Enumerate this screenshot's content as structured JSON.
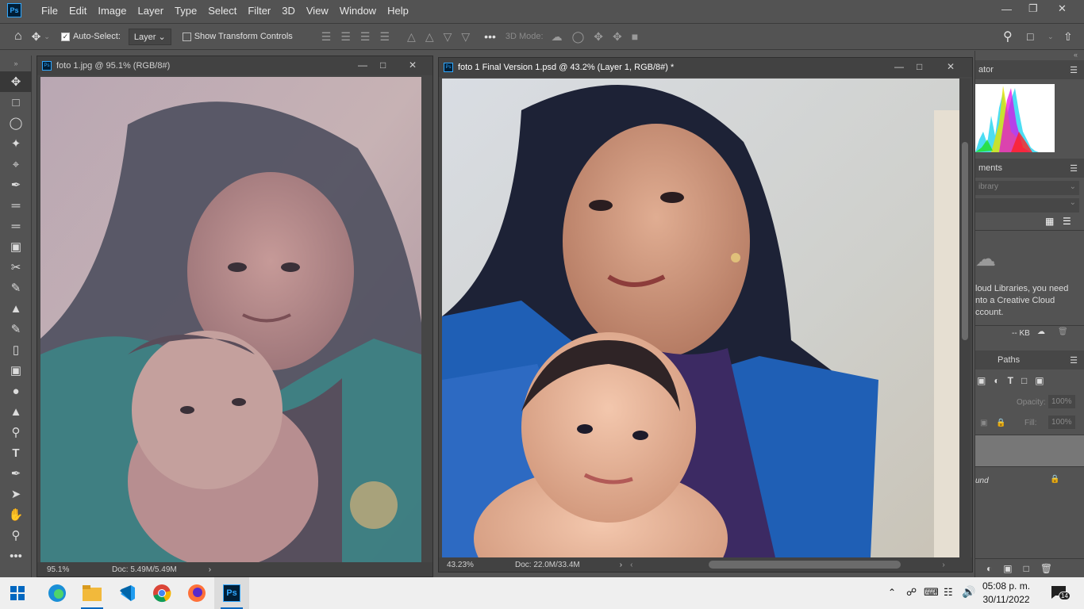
{
  "menubar": {
    "logo": "Ps",
    "items": [
      "File",
      "Edit",
      "Image",
      "Layer",
      "Type",
      "Select",
      "Filter",
      "3D",
      "View",
      "Window",
      "Help"
    ]
  },
  "optbar": {
    "auto_select_label": "Auto-Select:",
    "auto_select_target": "Layer",
    "show_transform_label": "Show Transform Controls",
    "mode_label": "3D Mode:"
  },
  "doc1": {
    "title": "foto 1.jpg @ 95.1% (RGB/8#)",
    "zoom": "95.1%",
    "doc": "Doc: 5.49M/5.49M"
  },
  "doc2": {
    "title": "foto 1 Final Version 1.psd @ 43.2% (Layer 1, RGB/8#) *",
    "zoom": "43.23%",
    "doc": "Doc: 22.0M/33.4M"
  },
  "panels": {
    "navigator_tab": "ator",
    "libraries_tab": "ments",
    "library_dropdown": "ibrary",
    "cc_message_line1": "loud Libraries, you need",
    "cc_message_line2": "nto a Creative Cloud",
    "cc_message_line3": "ccount.",
    "kb": "-- KB",
    "paths_tab": "Paths",
    "opacity_label": "Opacity:",
    "opacity_value": "100%",
    "fill_label": "Fill:",
    "fill_value": "100%",
    "layer_name": "und"
  },
  "taskbar": {
    "time": "05:08 p. m.",
    "date": "30/11/2022",
    "notifications": "14"
  },
  "colors": {
    "ps_blue": "#31a8ff",
    "ui_bg": "#535353",
    "taskbar_bg": "#efefef"
  }
}
